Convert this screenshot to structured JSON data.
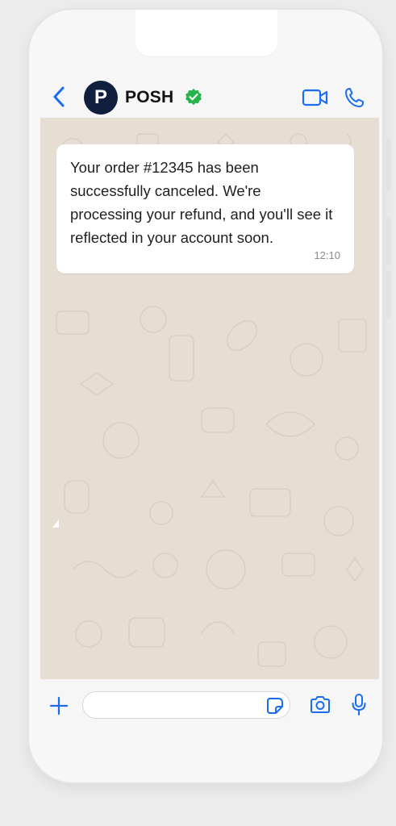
{
  "header": {
    "avatar_letter": "P",
    "contact_name": "POSH",
    "verified": true
  },
  "messages": [
    {
      "text": "Your order #12345 has been successfully canceled. We're processing your refund, and you'll see it reflected in your account soon.",
      "time": "12:10"
    }
  ],
  "composer": {
    "value": "",
    "placeholder": ""
  },
  "icons": {
    "back": "chevron-left-icon",
    "verified": "verified-badge-icon",
    "video": "video-call-icon",
    "phone": "phone-call-icon",
    "plus": "plus-icon",
    "sticker": "sticker-icon",
    "camera": "camera-icon",
    "mic": "microphone-icon"
  },
  "colors": {
    "accent": "#1b6df0",
    "avatar_bg": "#0f1f3d",
    "verified": "#25b34b",
    "chat_bg": "#e6ded3",
    "bubble_bg": "#ffffff"
  }
}
